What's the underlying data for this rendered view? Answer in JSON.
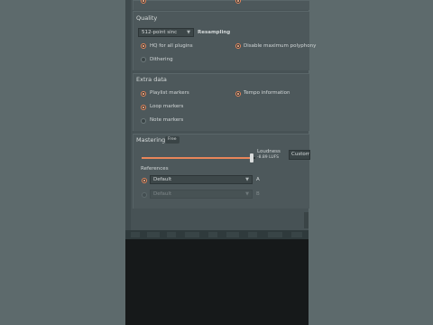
{
  "top_options": [
    "",
    ""
  ],
  "quality": {
    "title": "Quality",
    "resampling_value": "512-point sinc",
    "resampling_label": "Resampling",
    "options": [
      {
        "label": "HQ for all plugins",
        "checked": true
      },
      {
        "label": "Disable maximum polyphony",
        "checked": true
      },
      {
        "label": "Dithering",
        "checked": false
      }
    ]
  },
  "extra_data": {
    "title": "Extra data",
    "options": [
      {
        "label": "Playlist markers",
        "checked": true
      },
      {
        "label": "Tempo information",
        "checked": true
      },
      {
        "label": "Loop markers",
        "checked": true
      },
      {
        "label": "Note markers",
        "checked": false
      }
    ]
  },
  "mastering": {
    "title": "Mastering",
    "badge": "Free",
    "loudness_label": "Loudness",
    "loudness_value": "-8.89 LUFS",
    "custom_label": "Custom",
    "slider_level": 0.97,
    "references_label": "References",
    "references": [
      {
        "value": "Default",
        "suffix": "A",
        "enabled": true
      },
      {
        "value": "Default",
        "suffix": "B",
        "enabled": false
      }
    ]
  },
  "colors": {
    "accent": "#e8865a",
    "panel": "#475255",
    "section": "#4d585b"
  }
}
